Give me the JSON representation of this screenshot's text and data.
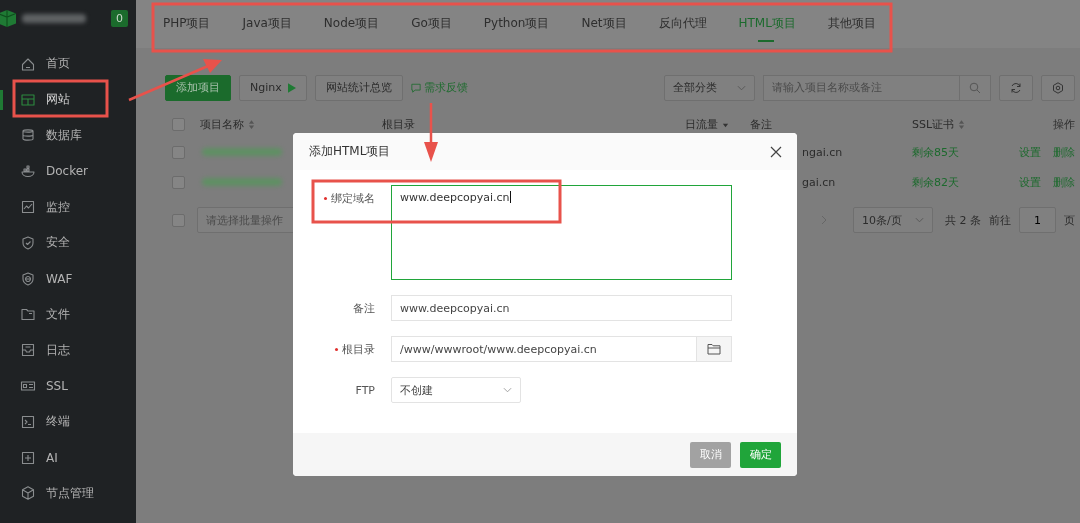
{
  "sidebar": {
    "badge": "0",
    "items": [
      {
        "label": "首页",
        "selected": false
      },
      {
        "label": "网站",
        "selected": true
      },
      {
        "label": "数据库",
        "selected": false
      },
      {
        "label": "Docker",
        "selected": false
      },
      {
        "label": "监控",
        "selected": false
      },
      {
        "label": "安全",
        "selected": false
      },
      {
        "label": "WAF",
        "selected": false
      },
      {
        "label": "文件",
        "selected": false
      },
      {
        "label": "日志",
        "selected": false
      },
      {
        "label": "SSL",
        "selected": false
      },
      {
        "label": "终端",
        "selected": false
      },
      {
        "label": "AI",
        "selected": false
      },
      {
        "label": "节点管理",
        "selected": false
      }
    ]
  },
  "tabs": [
    {
      "label": "PHP项目",
      "selected": false
    },
    {
      "label": "Java项目",
      "selected": false
    },
    {
      "label": "Node项目",
      "selected": false
    },
    {
      "label": "Go项目",
      "selected": false
    },
    {
      "label": "Python项目",
      "selected": false
    },
    {
      "label": "Net项目",
      "selected": false
    },
    {
      "label": "反向代理",
      "selected": false
    },
    {
      "label": "HTML项目",
      "selected": true
    },
    {
      "label": "其他项目",
      "selected": false
    }
  ],
  "toolbar": {
    "add_button": "添加项目",
    "nginx_button": "Nginx",
    "stats_button": "网站统计总览",
    "feedback_link": "需求反馈",
    "category_select": "全部分类",
    "search": {
      "placeholder": "请输入项目名称或备注"
    }
  },
  "table": {
    "all_checked": false,
    "columns": [
      "项目名称",
      "根目录",
      "日流量",
      "备注",
      "SSL证书",
      "操作"
    ],
    "rows": [
      {
        "checked": false,
        "remark": "ngai.cn",
        "ssl": "剩余85天",
        "actions": [
          "设置",
          "删除"
        ]
      },
      {
        "checked": false,
        "remark": "gai.cn",
        "ssl": "剩余82天",
        "actions": [
          "设置",
          "删除"
        ]
      }
    ]
  },
  "pagination": {
    "batch_checked": false,
    "batch_select": {
      "placeholder": "请选择批量操作"
    },
    "page_size": "10条/页",
    "total": "共 2 条",
    "goto_label": "前往",
    "page": "1",
    "page_suffix": "页"
  },
  "dialog": {
    "title": "添加HTML项目",
    "fields": [
      {
        "kind": "textarea",
        "label": "绑定域名",
        "required": true,
        "focused": true,
        "value": "www.deepcopyai.cn"
      },
      {
        "kind": "input",
        "label": "备注",
        "required": false,
        "value": "www.deepcopyai.cn"
      },
      {
        "kind": "path",
        "label": "根目录",
        "required": true,
        "value": "/www/wwwroot/www.deepcopyai.cn"
      },
      {
        "kind": "select",
        "label": "FTP",
        "required": false,
        "value": "不创建"
      }
    ],
    "buttons": [
      {
        "label": "取消",
        "kind": "secondary"
      },
      {
        "label": "确定",
        "kind": "primary"
      }
    ]
  }
}
